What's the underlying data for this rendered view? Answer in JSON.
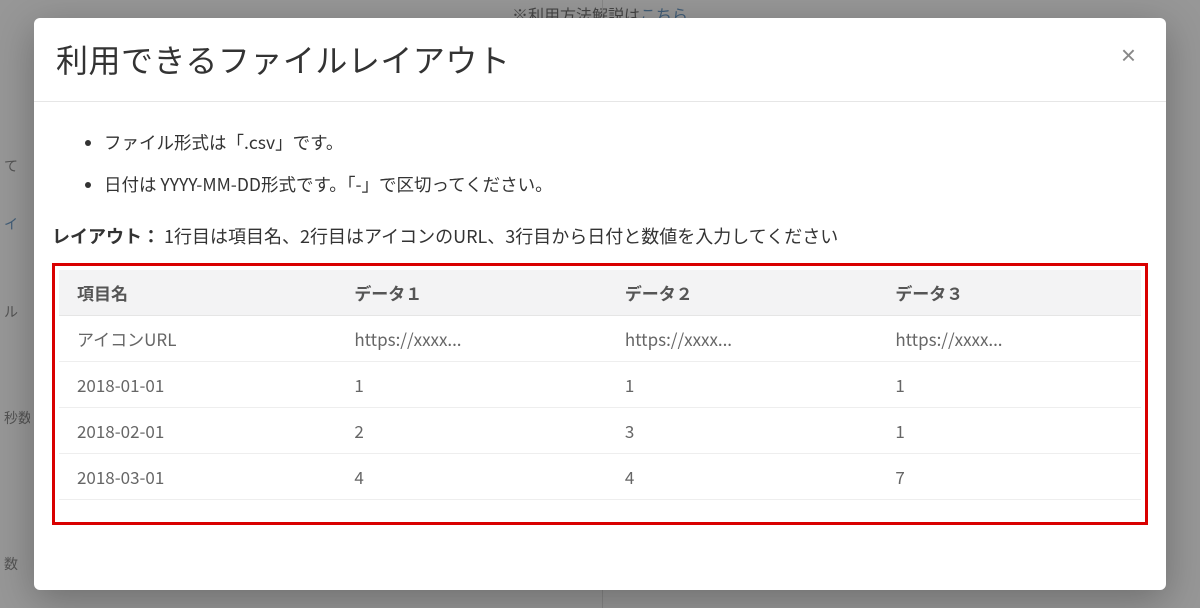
{
  "background": {
    "header_hint_pre": "※利用方法解説は",
    "header_hint_link": "こちら",
    "left_items": [
      "て",
      "イ",
      "",
      "ル",
      "",
      "秒数",
      "",
      "数"
    ]
  },
  "modal": {
    "title": "利用できるファイルレイアウト",
    "close_label": "×",
    "bullets": [
      "ファイル形式は「.csv」です。",
      "日付は YYYY-MM-DD形式です。「-」で区切ってください。"
    ],
    "layout_label": "レイアウト：",
    "layout_desc": "1行目は項目名、2行目はアイコンのURL、3行目から日付と数値を入力してください",
    "table": {
      "headers": [
        "項目名",
        "データ１",
        "データ２",
        "データ３"
      ],
      "rows": [
        [
          "アイコンURL",
          "https://xxxx...",
          "https://xxxx...",
          "https://xxxx..."
        ],
        [
          "2018-01-01",
          "1",
          "1",
          "1"
        ],
        [
          "2018-02-01",
          "2",
          "3",
          "1"
        ],
        [
          "2018-03-01",
          "4",
          "4",
          "7"
        ]
      ]
    }
  }
}
